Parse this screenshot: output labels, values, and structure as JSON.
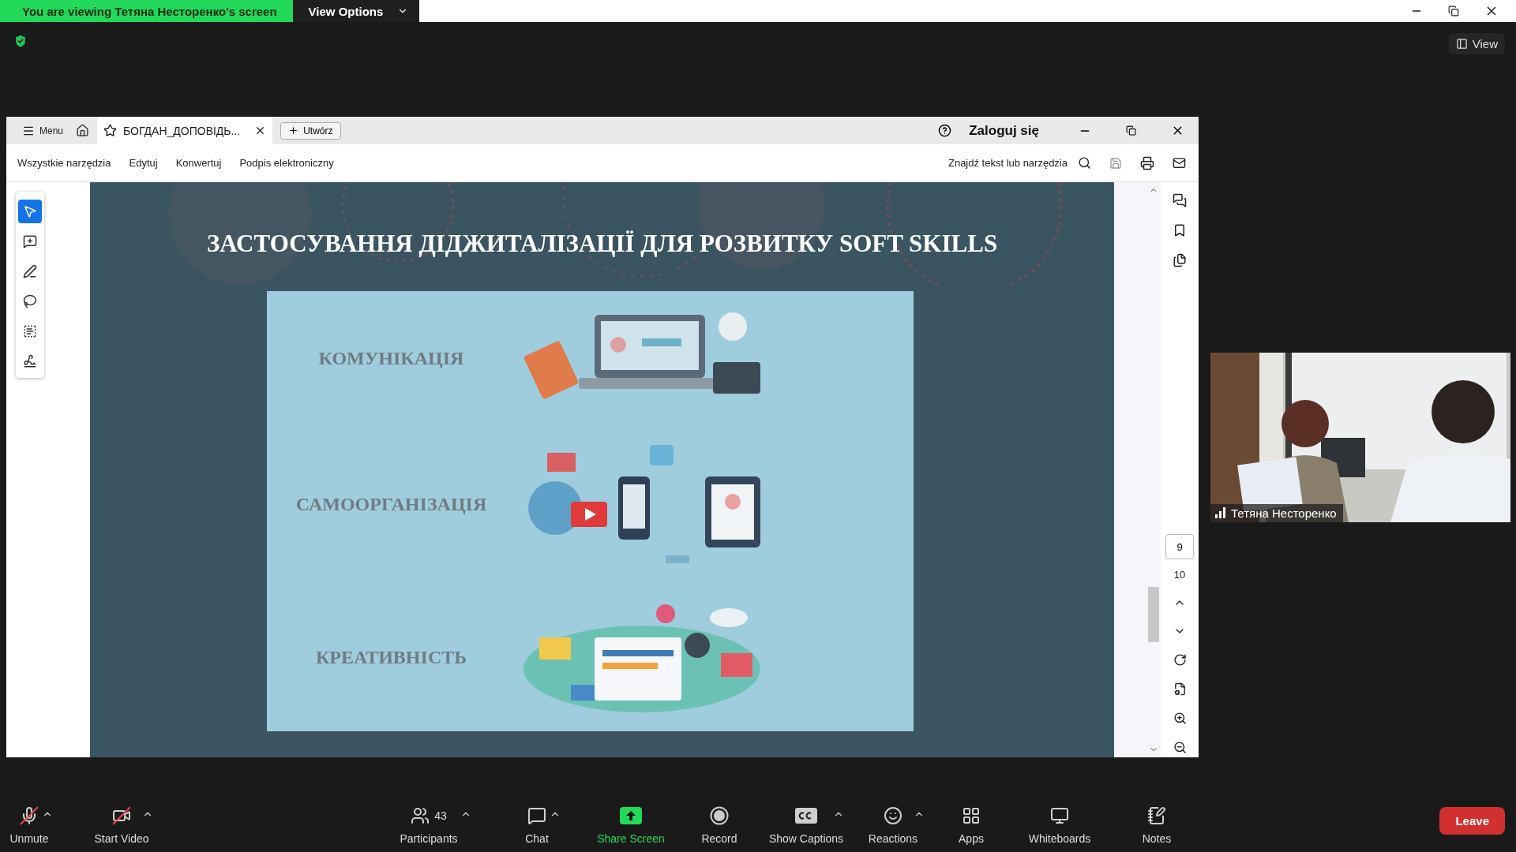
{
  "share_banner": {
    "text": "You are viewing Тетяна Несторенко's screen",
    "options_button": "View Options"
  },
  "view_button": "View",
  "reader": {
    "menu_button": "Menu",
    "tab": {
      "title": "БОГДАН_ДОПОВІДЬ...",
      "selected": true
    },
    "new_button": "Utwórz",
    "sign_in": "Zaloguj się",
    "menu_items": [
      "Wszystkie narzędzia",
      "Edytuj",
      "Konwertuj",
      "Podpis elektroniczny"
    ],
    "search": {
      "placeholder": "Znajdź tekst lub narzędzia"
    },
    "tools": [
      {
        "kind": "select",
        "selected": true
      },
      {
        "kind": "comment",
        "selected": false
      },
      {
        "kind": "pen",
        "selected": false
      },
      {
        "kind": "lasso",
        "selected": false
      },
      {
        "kind": "text",
        "selected": false
      },
      {
        "kind": "sign",
        "selected": false
      }
    ],
    "page_nav": {
      "current": "9",
      "total": "10"
    }
  },
  "slide": {
    "title": "ЗАСТОСУВАННЯ ДІДЖИТАЛІЗАЦІЇ ДЛЯ РОЗВИТКУ SOFT SKILLS",
    "items": [
      {
        "label": "КОМУНІКАЦІЯ",
        "kind": "picture"
      },
      {
        "label": "САМООРГАНІЗАЦІЯ",
        "kind": "picture"
      },
      {
        "label": "КРЕАТИВНІСТЬ",
        "kind": "picture"
      }
    ]
  },
  "video": {
    "name": "Тетяна Несторенко",
    "kind": "picture"
  },
  "toolbar": [
    {
      "label": "Unmute",
      "kind": "mic",
      "off": true,
      "menu": true
    },
    {
      "label": "Start Video",
      "kind": "video",
      "off": true,
      "menu": true
    },
    {
      "label": "Participants",
      "kind": "participants",
      "count": "43",
      "off": false,
      "menu": true
    },
    {
      "label": "Chat",
      "kind": "chat",
      "off": false,
      "menu": true
    },
    {
      "label": "Share Screen",
      "kind": "share",
      "off": false,
      "menu": false
    },
    {
      "label": "Record",
      "kind": "record",
      "off": false,
      "menu": false
    },
    {
      "label": "Show Captions",
      "kind": "captions",
      "off": false,
      "menu": true
    },
    {
      "label": "Reactions",
      "kind": "reactions",
      "off": false,
      "menu": true
    },
    {
      "label": "Apps",
      "kind": "apps",
      "off": false,
      "menu": false
    },
    {
      "label": "Whiteboards",
      "kind": "whiteboards",
      "off": false,
      "menu": false
    },
    {
      "label": "Notes",
      "kind": "notes",
      "off": false,
      "menu": false
    }
  ],
  "leave_button": "Leave"
}
